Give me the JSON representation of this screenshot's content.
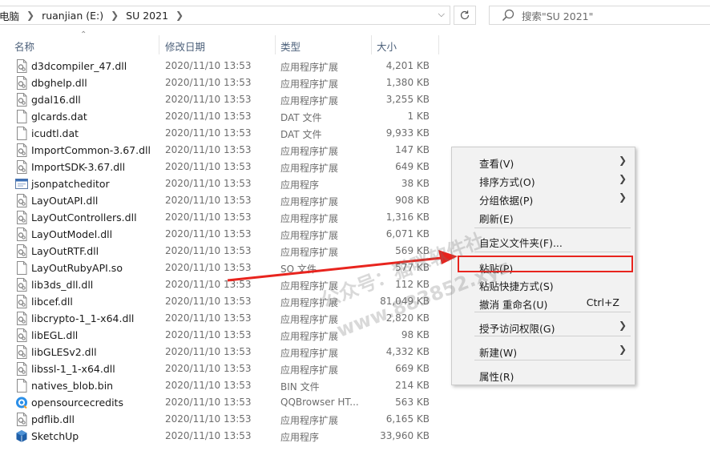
{
  "address": {
    "crumbs": [
      "电脑",
      "ruanjian (E:)",
      "SU 2021"
    ]
  },
  "search": {
    "placeholder": "搜索\"SU 2021\""
  },
  "columns": {
    "name": "名称",
    "date": "修改日期",
    "type": "类型",
    "size": "大小"
  },
  "files": [
    {
      "name": "d3dcompiler_47.dll",
      "date": "2020/11/10 13:53",
      "type": "应用程序扩展",
      "size": "4,201 KB",
      "icon": "dll-file-icon"
    },
    {
      "name": "dbghelp.dll",
      "date": "2020/11/10 13:53",
      "type": "应用程序扩展",
      "size": "1,380 KB",
      "icon": "dll-file-icon"
    },
    {
      "name": "gdal16.dll",
      "date": "2020/11/10 13:53",
      "type": "应用程序扩展",
      "size": "3,255 KB",
      "icon": "dll-file-icon"
    },
    {
      "name": "glcards.dat",
      "date": "2020/11/10 13:53",
      "type": "DAT 文件",
      "size": "1 KB",
      "icon": "blank-file-icon"
    },
    {
      "name": "icudtl.dat",
      "date": "2020/11/10 13:53",
      "type": "DAT 文件",
      "size": "9,933 KB",
      "icon": "blank-file-icon"
    },
    {
      "name": "ImportCommon-3.67.dll",
      "date": "2020/11/10 13:53",
      "type": "应用程序扩展",
      "size": "147 KB",
      "icon": "dll-file-icon"
    },
    {
      "name": "ImportSDK-3.67.dll",
      "date": "2020/11/10 13:53",
      "type": "应用程序扩展",
      "size": "649 KB",
      "icon": "dll-file-icon"
    },
    {
      "name": "jsonpatcheditor",
      "date": "2020/11/10 13:53",
      "type": "应用程序",
      "size": "38 KB",
      "icon": "exe-window-icon"
    },
    {
      "name": "LayOutAPI.dll",
      "date": "2020/11/10 13:53",
      "type": "应用程序扩展",
      "size": "908 KB",
      "icon": "dll-file-icon"
    },
    {
      "name": "LayOutControllers.dll",
      "date": "2020/11/10 13:53",
      "type": "应用程序扩展",
      "size": "1,316 KB",
      "icon": "dll-file-icon"
    },
    {
      "name": "LayOutModel.dll",
      "date": "2020/11/10 13:53",
      "type": "应用程序扩展",
      "size": "6,071 KB",
      "icon": "dll-file-icon"
    },
    {
      "name": "LayOutRTF.dll",
      "date": "2020/11/10 13:53",
      "type": "应用程序扩展",
      "size": "569 KB",
      "icon": "dll-file-icon"
    },
    {
      "name": "LayOutRubyAPI.so",
      "date": "2020/11/10 13:53",
      "type": "SO 文件",
      "size": "577 KB",
      "icon": "blank-file-icon"
    },
    {
      "name": "lib3ds_dll.dll",
      "date": "2020/11/10 13:53",
      "type": "应用程序扩展",
      "size": "112 KB",
      "icon": "dll-file-icon"
    },
    {
      "name": "libcef.dll",
      "date": "2020/11/10 13:53",
      "type": "应用程序扩展",
      "size": "81,049 KB",
      "icon": "dll-file-icon"
    },
    {
      "name": "libcrypto-1_1-x64.dll",
      "date": "2020/11/10 13:53",
      "type": "应用程序扩展",
      "size": "2,820 KB",
      "icon": "dll-file-icon"
    },
    {
      "name": "libEGL.dll",
      "date": "2020/11/10 13:53",
      "type": "应用程序扩展",
      "size": "98 KB",
      "icon": "dll-file-icon"
    },
    {
      "name": "libGLESv2.dll",
      "date": "2020/11/10 13:53",
      "type": "应用程序扩展",
      "size": "4,332 KB",
      "icon": "dll-file-icon"
    },
    {
      "name": "libssl-1_1-x64.dll",
      "date": "2020/11/10 13:53",
      "type": "应用程序扩展",
      "size": "669 KB",
      "icon": "dll-file-icon"
    },
    {
      "name": "natives_blob.bin",
      "date": "2020/11/10 13:53",
      "type": "BIN 文件",
      "size": "214 KB",
      "icon": "blank-file-icon"
    },
    {
      "name": "opensourcecredits",
      "date": "2020/11/10 13:53",
      "type": "QQBrowser HT...",
      "size": "563 KB",
      "icon": "browser-html-icon"
    },
    {
      "name": "pdflib.dll",
      "date": "2020/11/10 13:53",
      "type": "应用程序扩展",
      "size": "6,165 KB",
      "icon": "dll-file-icon"
    },
    {
      "name": "SketchUp",
      "date": "2020/11/10 13:53",
      "type": "应用程序",
      "size": "33,960 KB",
      "icon": "sketchup-app-icon"
    }
  ],
  "context_menu": {
    "items": [
      {
        "label": "查看(V)",
        "submenu": true
      },
      {
        "label": "排序方式(O)",
        "submenu": true
      },
      {
        "label": "分组依据(P)",
        "submenu": true
      },
      {
        "label": "刷新(E)"
      },
      {
        "label": "自定义文件夹(F)..."
      },
      {
        "label": "粘贴(P)",
        "highlighted": true
      },
      {
        "label": "粘贴快捷方式(S)"
      },
      {
        "label": "撤消 重命名(U)",
        "shortcut": "Ctrl+Z"
      },
      {
        "label": "授予访问权限(G)",
        "submenu": true
      },
      {
        "label": "新建(W)",
        "submenu": true
      },
      {
        "label": "属性(R)"
      }
    ],
    "highlight_color": "#e8241e"
  },
  "annotation": {
    "arrow_color": "#e8241e",
    "watermark_line1": "公众号：猫咪软件社",
    "watermark_line2": "www.883852.xyz"
  }
}
